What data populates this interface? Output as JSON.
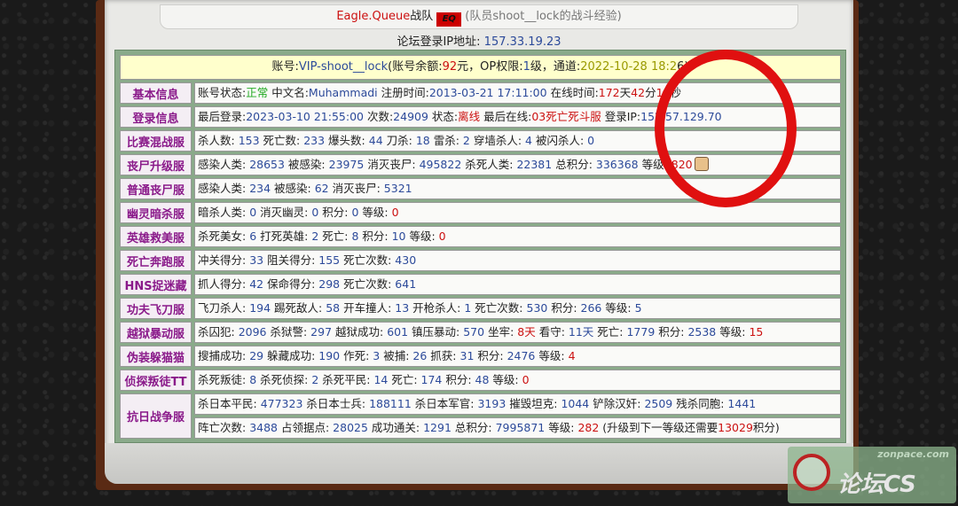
{
  "header": {
    "team_name": "Eagle.Queue",
    "team_suffix": "战队",
    "logo_text": "EQ",
    "member_text": "(队员shoot__lock的战斗经验)"
  },
  "ip_line": {
    "label": "论坛登录IP地址:",
    "value": "157.33.19.23"
  },
  "account": {
    "prefix": "账号:",
    "name": "VIP-shoot__lock",
    "balance_label": "(账号余额:",
    "balance": "92",
    "balance_unit": "元，OP权限:",
    "op": "1",
    "op_unit": "级，通道:",
    "date": "2022-10-28 18:2",
    "date_tail": "6)"
  },
  "rows": {
    "basic": {
      "label": "基本信息",
      "t1": "账号状态:",
      "status": "正常",
      "t2": " 中文名:",
      "cname": "Muhammadi",
      "t3": " 注册时间:",
      "reg": "2013-03-21 17:11:00",
      "t4": " 在线时间:",
      "days": "172",
      "t5": "天",
      "hours": "42",
      "t6": "分",
      "secs": "10",
      "t7": "秒"
    },
    "login": {
      "label": "登录信息",
      "t1": "最后登录:",
      "last": "2023-03-10 21:55:00",
      "t2": " 次数:",
      "count": "24909",
      "t3": " 状态:",
      "state": "离线",
      "t4": " 最后在线:",
      "server": "03死亡死斗服",
      "t5": " 登录IP:",
      "ip": "152.57.129.70"
    },
    "match": {
      "label": "比赛混战服",
      "text": [
        "杀人数: ",
        "153",
        " 死亡数: ",
        "233",
        " 爆头数: ",
        "44",
        " 刀杀: ",
        "18",
        " 雷杀: ",
        "2",
        " 穿墙杀人: ",
        "4",
        " 被闪杀人: ",
        "0"
      ]
    },
    "zombie_up": {
      "label": "丧尸升级服",
      "text": [
        "感染人类: ",
        "28653",
        " 被感染: ",
        "23975",
        " 消灭丧尸: ",
        "495822",
        " 杀死人类: ",
        "22381",
        " 总积分: ",
        "336368",
        " 等级: "
      ],
      "level": "820"
    },
    "zombie": {
      "label": "普通丧尸服",
      "text": [
        "感染人类: ",
        "234",
        " 被感染: ",
        "62",
        " 消灭丧尸: ",
        "5321"
      ]
    },
    "ghost": {
      "label": "幽灵暗杀服",
      "text": [
        "暗杀人类: ",
        "0",
        " 消灭幽灵: ",
        "0",
        " 积分: ",
        "0",
        " 等级: "
      ],
      "level": "0"
    },
    "hero": {
      "label": "英雄救美服",
      "text": [
        "杀死美女: ",
        "6",
        " 打死英雄: ",
        "2",
        " 死亡: ",
        "8",
        " 积分: ",
        "10",
        " 等级: "
      ],
      "level": "0"
    },
    "deathrun": {
      "label": "死亡奔跑服",
      "text": [
        "冲关得分: ",
        "33",
        " 阻关得分: ",
        "155",
        " 死亡次数: ",
        "430"
      ]
    },
    "hns": {
      "label": "HNS捉迷藏",
      "text": [
        "抓人得分: ",
        "42",
        " 保命得分: ",
        "298",
        " 死亡次数: ",
        "641"
      ]
    },
    "kungfu": {
      "label": "功夫飞刀服",
      "text": [
        "飞刀杀人: ",
        "194",
        " 踢死敌人: ",
        "58",
        " 开车撞人: ",
        "13",
        " 开枪杀人: ",
        "1",
        " 死亡次数: ",
        "530",
        " 积分: ",
        "266",
        " 等级: ",
        "5"
      ]
    },
    "jail": {
      "label": "越狱暴动服",
      "text": [
        "杀囚犯: ",
        "2096",
        " 杀狱警: ",
        "297",
        " 越狱成功: ",
        "601",
        " 镇压暴动: ",
        "570",
        " 坐牢: "
      ],
      "jail_days": "8天",
      "t_guard": " 看守: ",
      "guard_days": "11天",
      "text2": [
        " 死亡: ",
        "1779",
        " 积分: ",
        "2538",
        " 等级: "
      ],
      "level": "15"
    },
    "hide": {
      "label": "伪装躲猫猫",
      "text": [
        "搜捕成功: ",
        "29",
        " 躲藏成功: ",
        "190",
        " 作死: ",
        "3",
        " 被捕: ",
        "26",
        " 抓获: ",
        "31",
        " 积分: ",
        "2476",
        " 等级: "
      ],
      "level": "4"
    },
    "ttt": {
      "label": "侦探叛徒TT",
      "text": [
        "杀死叛徒: ",
        "8",
        " 杀死侦探: ",
        "2",
        " 杀死平民: ",
        "14",
        " 死亡: ",
        "174",
        " 积分: ",
        "48",
        " 等级: "
      ],
      "level": "0"
    },
    "war": {
      "label": "抗日战争服",
      "line1": [
        "杀日本平民: ",
        "477323",
        " 杀日本士兵: ",
        "188111",
        " 杀日本军官: ",
        "3193",
        " 摧毁坦克: ",
        "1044",
        " 铲除汉奸: ",
        "2509",
        " 残杀同胞: ",
        "1441"
      ],
      "line2": [
        "阵亡次数: ",
        "3488",
        " 占领据点: ",
        "28025",
        " 成功通关: ",
        "1291",
        " 总积分: ",
        "7995871",
        " 等级: "
      ],
      "level": "282",
      "tail_a": " (升级到下一等级还需要",
      "tail_b": "13029",
      "tail_c": "积分)"
    }
  },
  "watermark": {
    "top": "zonpace.com",
    "text": "论坛CS"
  },
  "colors": {
    "frame": "#5a2a14",
    "label_text": "#8a1a8a",
    "value_blue": "#2c4a9a",
    "value_red": "#cc1111",
    "circle": "#e01010"
  }
}
